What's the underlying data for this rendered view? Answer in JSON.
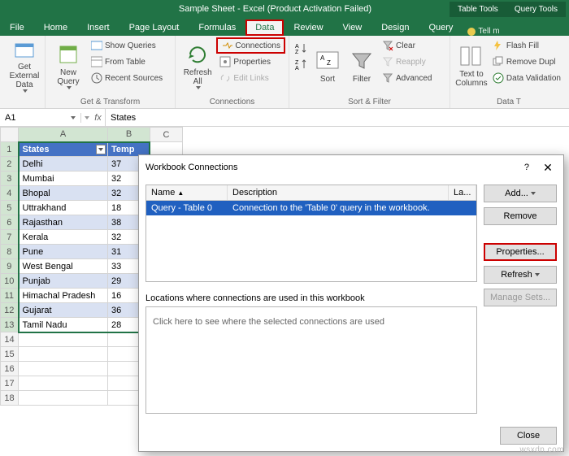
{
  "titlebar": {
    "title": "Sample Sheet - Excel (Product Activation Failed)",
    "ttab1": "Table Tools",
    "ttab2": "Query Tools"
  },
  "tabs": {
    "file": "File",
    "home": "Home",
    "insert": "Insert",
    "page": "Page Layout",
    "formulas": "Formulas",
    "data": "Data",
    "review": "Review",
    "view": "View",
    "design": "Design",
    "query": "Query",
    "tell": "Tell m"
  },
  "ribbon": {
    "getexternal": "Get External\nData",
    "newquery": "New\nQuery",
    "show": "Show Queries",
    "fromtable": "From Table",
    "recent": "Recent Sources",
    "gt": "Get & Transform",
    "refresh": "Refresh\nAll",
    "connections": "Connections",
    "properties": "Properties",
    "editlinks": "Edit Links",
    "conn_grp": "Connections",
    "sort": "Sort",
    "filter": "Filter",
    "clear": "Clear",
    "reapply": "Reapply",
    "advanced": "Advanced",
    "sf": "Sort & Filter",
    "ttc": "Text to\nColumns",
    "flash": "Flash Fill",
    "rmdup": "Remove Dupl",
    "dval": "Data Validation",
    "dt": "Data T"
  },
  "namebox": "A1",
  "fx": "fx",
  "formula": "States",
  "cols": {
    "a": "A",
    "b": "B",
    "c": "C"
  },
  "hdr": {
    "states": "States",
    "temp": "Temp"
  },
  "rows": [
    {
      "n": "1"
    },
    {
      "n": "2",
      "a": "Delhi",
      "b": "37"
    },
    {
      "n": "3",
      "a": "Mumbai",
      "b": "32"
    },
    {
      "n": "4",
      "a": "Bhopal",
      "b": "32"
    },
    {
      "n": "5",
      "a": "Uttrakhand",
      "b": "18"
    },
    {
      "n": "6",
      "a": "Rajasthan",
      "b": "38"
    },
    {
      "n": "7",
      "a": "Kerala",
      "b": "32"
    },
    {
      "n": "8",
      "a": "Pune",
      "b": "31"
    },
    {
      "n": "9",
      "a": "West Bengal",
      "b": "33"
    },
    {
      "n": "10",
      "a": "Punjab",
      "b": "29"
    },
    {
      "n": "11",
      "a": "Himachal Pradesh",
      "b": "16"
    },
    {
      "n": "12",
      "a": "Gujarat",
      "b": "36"
    },
    {
      "n": "13",
      "a": "Tamil Nadu",
      "b": "28"
    },
    {
      "n": "14"
    },
    {
      "n": "15"
    },
    {
      "n": "16"
    },
    {
      "n": "17"
    },
    {
      "n": "18"
    }
  ],
  "dialog": {
    "title": "Workbook Connections",
    "help": "?",
    "close_x": "✕",
    "col_name": "Name",
    "col_desc": "Description",
    "col_la": "La...",
    "row_name": "Query - Table 0",
    "row_desc": "Connection to the 'Table 0' query in the workbook.",
    "loc_label": "Locations where connections are used in this workbook",
    "loc_hint": "Click here to see where the selected connections are used",
    "add": "Add...",
    "remove": "Remove",
    "properties": "Properties...",
    "refresh": "Refresh",
    "manage": "Manage Sets...",
    "close": "Close"
  },
  "wm": "wsxdn.com"
}
